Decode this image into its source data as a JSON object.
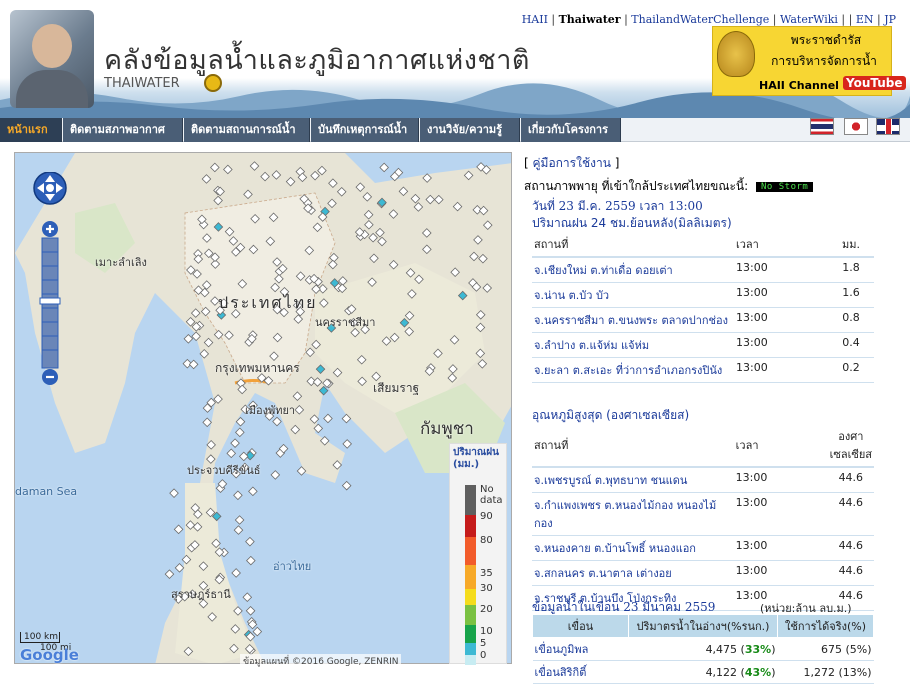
{
  "header": {
    "site_title": "คลังข้อมูลน้ำและภูมิอากาศแห่งชาติ",
    "site_sub": "THAIWATER",
    "top_links": [
      {
        "label": "HAII",
        "current": false
      },
      {
        "label": "Thaiwater",
        "current": true
      },
      {
        "label": "ThailandWaterChellenge",
        "current": false
      },
      {
        "label": "WaterWiki",
        "current": false
      },
      {
        "label": "EN",
        "current": false
      },
      {
        "label": "JP",
        "current": false
      }
    ],
    "royal": {
      "line1": "พระราชดำรัส",
      "line2": "การบริหารจัดการน้ำ",
      "channel": "HAII Channel",
      "youtube": "YouTube"
    }
  },
  "nav": {
    "items": [
      "หน้าแรก",
      "ติดตามสภาพอากาศ",
      "ติดตามสถานการณ์น้ำ",
      "บันทึกเหตุการณ์น้ำ",
      "งานวิจัย/ความรู้",
      "เกี่ยวกับโครงการ"
    ],
    "active_index": 0
  },
  "map": {
    "labels": {
      "country": "ประเทศไทย",
      "cambodia": "กัมพูชา",
      "andaman": "daman Sea",
      "myanmar": "เมาะลำเลิง",
      "khon": "นครราชสีมา",
      "pattaya": "เมืองพัทยา",
      "siemreap": "เสียมราฐ",
      "prachuap": "ประจวบคีรีขันธ์",
      "gulf": "อ่าวไทย",
      "surat": "สุราษฎร์ธานี",
      "bangkok": "กรุงเทพมหานคร"
    },
    "legend": {
      "title": "ปริมาณฝน (มม.)",
      "levels": [
        "No data",
        "90",
        "80",
        "35",
        "30",
        "20",
        "10",
        "5",
        "0"
      ]
    },
    "scale_km": "100 km",
    "scale_mi": "100 mi",
    "google": "Google",
    "copyright": "ข้อมูลแผนที่ ©2016 Google, ZENRIN"
  },
  "side": {
    "manual": "คู่มือการใช้งาน",
    "storm_label": "สถานภาพพายุ ที่เข้าใกล้ประเทศไทยขณะนี้:",
    "storm_status": "No Storm",
    "report_date": "วันที่ 23 มี.ค. 2559 เวลา 13:00",
    "rain": {
      "title": "ปริมาณฝน 24 ชม.ย้อนหลัง(มิลลิเมตร)",
      "headers": [
        "สถานที่",
        "เวลา",
        "มม."
      ],
      "rows": [
        {
          "place": "จ.เชียงใหม่ ต.ท่าเดื่อ ดอยเต่า",
          "time": "13:00",
          "value": "1.8"
        },
        {
          "place": "จ.น่าน ต.บัว บัว",
          "time": "13:00",
          "value": "1.6"
        },
        {
          "place": "จ.นครราชสีมา ต.ขนงพระ ตลาดปากช่อง",
          "time": "13:00",
          "value": "0.8"
        },
        {
          "place": "จ.ลำปาง ต.แจ้ห่ม แจ้ห่ม",
          "time": "13:00",
          "value": "0.4"
        },
        {
          "place": "จ.ยะลา ต.สะเอะ ที่ว่าการอำเภอกรงปินัง",
          "time": "13:00",
          "value": "0.2"
        }
      ]
    },
    "temp": {
      "title": "อุณหภูมิสูงสุด (องศาเซลเซียส)",
      "headers": [
        "สถานที่",
        "เวลา",
        "องศาเซลเซียส"
      ],
      "rows": [
        {
          "place": "จ.เพชรบูรณ์ ต.พุทธบาท ชนแดน",
          "time": "13:00",
          "value": "44.6"
        },
        {
          "place": "จ.กำแพงเพชร ต.หนองไม้กอง หนองไม้กอง",
          "time": "13:00",
          "value": "44.6"
        },
        {
          "place": "จ.หนองคาย ต.บ้านโพธิ์ หนองแอก",
          "time": "13:00",
          "value": "44.6"
        },
        {
          "place": "จ.สกลนคร ต.นาตาล เต่างอย",
          "time": "13:00",
          "value": "44.6"
        },
        {
          "place": "จ.ราชบุรี ต.บ้านบึง โป่งกระทิง",
          "time": "13:00",
          "value": "44.6"
        }
      ]
    },
    "dam": {
      "title": "ข้อมูลน้ำในเขื่อน 23 มีนาคม 2559",
      "unit": "(หน่วย:ล้าน ลบ.ม.)",
      "headers": [
        "เขื่อน",
        "ปริมาตรน้ำในอ่างฯ(%รนก.)",
        "ใช้การได้จริง(%)"
      ],
      "rows": [
        {
          "name": "เขื่อนภูมิพล",
          "volume": "4,475",
          "vol_pct": "33%",
          "usable": "675 (5%)"
        },
        {
          "name": "เขื่อนสิริกิติ์",
          "volume": "4,122",
          "vol_pct": "43%",
          "usable": "1,272 (13%)"
        }
      ]
    }
  },
  "colors": {
    "nav_bg": "#4a5e76",
    "nav_active_text": "#f7a928",
    "link": "#1a3a9a",
    "storm_text": "#4ee24e",
    "royal_bg": "#f7d633"
  },
  "icons": [
    "pan-control-icon",
    "zoom-in-icon",
    "zoom-out-icon",
    "station-marker-icon",
    "royal-emblem-icon",
    "youtube-icon",
    "flag-th-icon",
    "flag-jp-icon",
    "flag-uk-icon"
  ]
}
